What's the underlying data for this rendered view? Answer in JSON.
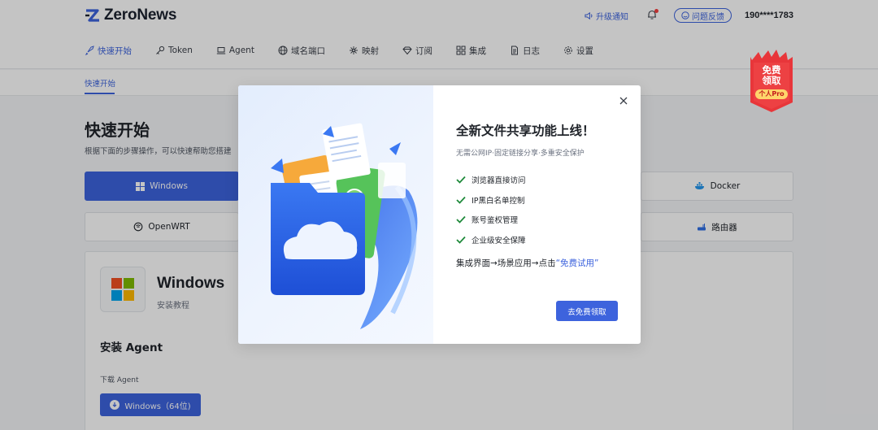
{
  "brand": {
    "name": "ZeroNews",
    "accent": "#3d63dd"
  },
  "header": {
    "upgrade_label": "升级通知",
    "feedback_label": "问题反馈",
    "phone": "190****1783"
  },
  "nav": {
    "items": [
      {
        "label": "快速开始",
        "icon": "rocket-icon",
        "active": true
      },
      {
        "label": "Token",
        "icon": "key-icon"
      },
      {
        "label": "Agent",
        "icon": "laptop-icon"
      },
      {
        "label": "域名端口",
        "icon": "globe-icon"
      },
      {
        "label": "映射",
        "icon": "network-icon"
      },
      {
        "label": "订阅",
        "icon": "diamond-icon"
      },
      {
        "label": "集成",
        "icon": "grid-icon"
      },
      {
        "label": "日志",
        "icon": "document-icon"
      },
      {
        "label": "设置",
        "icon": "gear-icon"
      }
    ]
  },
  "breadcrumb": {
    "current": "快速开始"
  },
  "page": {
    "title": "快速开始",
    "subtitle": "根据下面的步骤操作，可以快速帮助您搭建"
  },
  "os_tiles": [
    {
      "label": "Windows",
      "icon": "windows-icon",
      "active": true
    },
    {
      "label": "Docker",
      "icon": "docker-icon"
    },
    {
      "label": "OpenWRT",
      "icon": "openwrt-icon"
    },
    {
      "label": "路由器",
      "icon": "router-icon"
    }
  ],
  "card": {
    "os_title": "Windows",
    "os_subtitle": "安装教程",
    "install_title": "安装 Agent",
    "download_label": "下载 Agent",
    "download_button": "Windows（64位)"
  },
  "promo_badge": {
    "line1": "免费",
    "line2": "领取",
    "pill": "个人Pro"
  },
  "modal": {
    "title": "全新文件共享功能上线！",
    "subtitle": "无需公网IP·固定链接分享·多重安全保护",
    "features": [
      "浏览器直接访问",
      "IP黑白名单控制",
      "账号鉴权管理",
      "企业级安全保障"
    ],
    "path_prefix": "集成界面→场景应用→点击",
    "path_highlight": "“免费试用”",
    "cta_label": "去免费领取"
  }
}
